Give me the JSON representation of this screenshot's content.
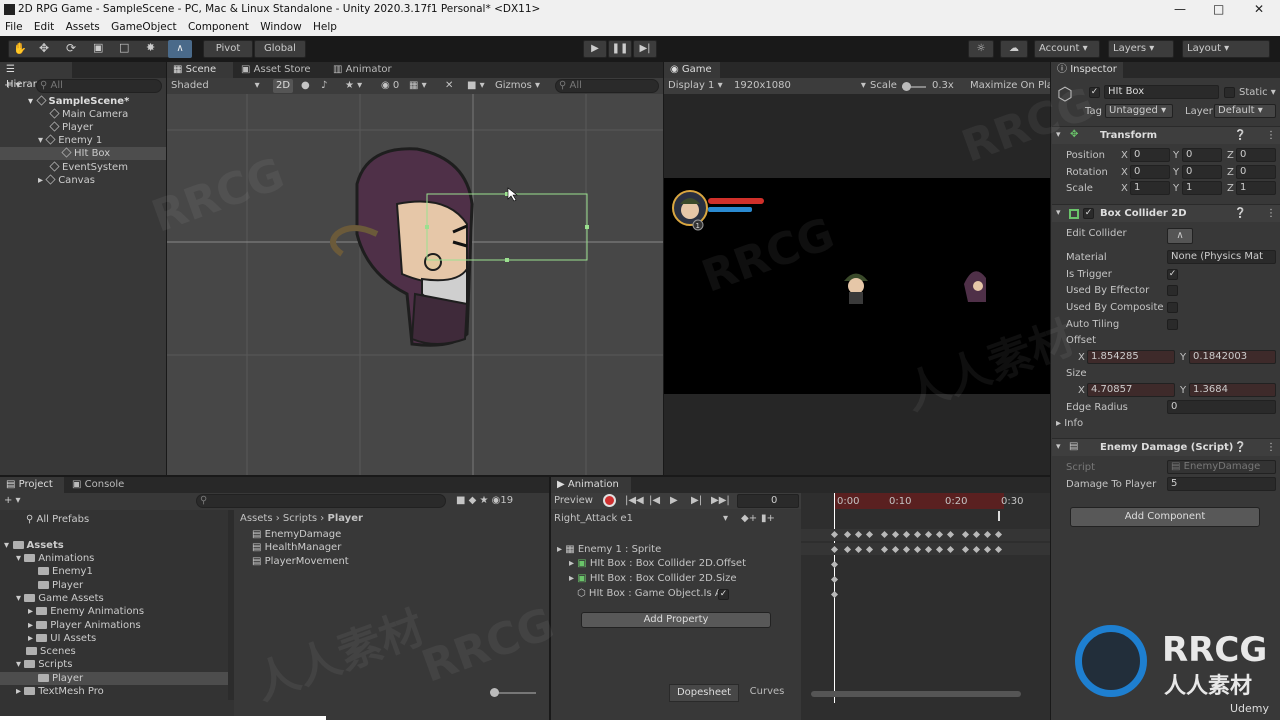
{
  "window": {
    "title": "2D RPG Game - SampleScene - PC, Mac & Linux Standalone - Unity 2020.3.17f1 Personal* <DX11>"
  },
  "menu": [
    "File",
    "Edit",
    "Assets",
    "GameObject",
    "Component",
    "Window",
    "Help"
  ],
  "toolbar": {
    "pivot": "Pivot",
    "global": "Global",
    "account": "Account",
    "layers": "Layers",
    "layout": "Layout"
  },
  "hierarchy": {
    "tab": "Hierarchy",
    "search_placeholder": "All",
    "items": [
      "SampleScene*",
      "Main Camera",
      "Player",
      "Enemy 1",
      "HIt Box",
      "EventSystem",
      "Canvas"
    ]
  },
  "scene": {
    "tabs": [
      "Scene",
      "Asset Store",
      "Animator"
    ],
    "shading": "Shaded",
    "mode_2d": "2D",
    "hidden_count": "0",
    "gizmos": "Gizmos",
    "search_placeholder": "All"
  },
  "game": {
    "tab": "Game",
    "display": "Display 1",
    "resolution": "1920x1080",
    "scale_label": "Scale",
    "scale_value": "0.3x",
    "maximize": "Maximize On Pla",
    "badge": "1"
  },
  "inspector": {
    "tab": "Inspector",
    "object_name": "HIt Box",
    "static_label": "Static",
    "tag_label": "Tag",
    "tag_value": "Untagged",
    "layer_label": "Layer",
    "layer_value": "Default",
    "transform": {
      "title": "Transform",
      "position_label": "Position",
      "position": [
        "0",
        "0",
        "0"
      ],
      "rotation_label": "Rotation",
      "rotation": [
        "0",
        "0",
        "0"
      ],
      "scale_label": "Scale",
      "scale": [
        "1",
        "1",
        "1"
      ]
    },
    "box_collider": {
      "title": "Box Collider 2D",
      "edit_collider": "Edit Collider",
      "material_label": "Material",
      "material_value": "None (Physics Mat",
      "is_trigger": "Is Trigger",
      "used_by_effector": "Used By Effector",
      "used_by_composite": "Used By Composite",
      "auto_tiling": "Auto Tiling",
      "offset_label": "Offset",
      "offset_x": "1.854285",
      "offset_y": "0.1842003",
      "size_label": "Size",
      "size_x": "4.70857",
      "size_y": "1.3684",
      "edge_radius_label": "Edge Radius",
      "edge_radius": "0",
      "info": "Info"
    },
    "enemy_damage": {
      "title": "Enemy Damage (Script)",
      "script_label": "Script",
      "script_value": "EnemyDamage",
      "damage_label": "Damage To Player",
      "damage_value": "5"
    },
    "add_component": "Add Component"
  },
  "project": {
    "tabs": [
      "Project",
      "Console"
    ],
    "hidden_count": "19",
    "all_prefabs": "All Prefabs",
    "tree": [
      "Assets",
      "Animations",
      "Enemy1",
      "Player",
      "Game Assets",
      "Enemy Animations",
      "Player Animations",
      "UI Assets",
      "Scenes",
      "Scripts",
      "Player",
      "TextMesh Pro"
    ],
    "breadcrumb": [
      "Assets",
      "Scripts",
      "Player"
    ],
    "files": [
      "EnemyDamage",
      "HealthManager",
      "PlayerMovement"
    ]
  },
  "animation": {
    "tab": "Animation",
    "preview": "Preview",
    "frame": "0",
    "clip": "Right_Attack e1",
    "ruler": [
      "0:00",
      "0:10",
      "0:20",
      "0:30"
    ],
    "properties": [
      "Enemy 1 : Sprite",
      "HIt Box : Box Collider 2D.Offset",
      "HIt Box : Box Collider 2D.Size",
      "HIt Box : Game Object.Is Ac"
    ],
    "add_property": "Add Property",
    "dopesheet": "Dopesheet",
    "curves": "Curves"
  },
  "watermark": {
    "user": "Udemy",
    "logo_text": "RRCG",
    "logo_sub": "人人素材"
  }
}
